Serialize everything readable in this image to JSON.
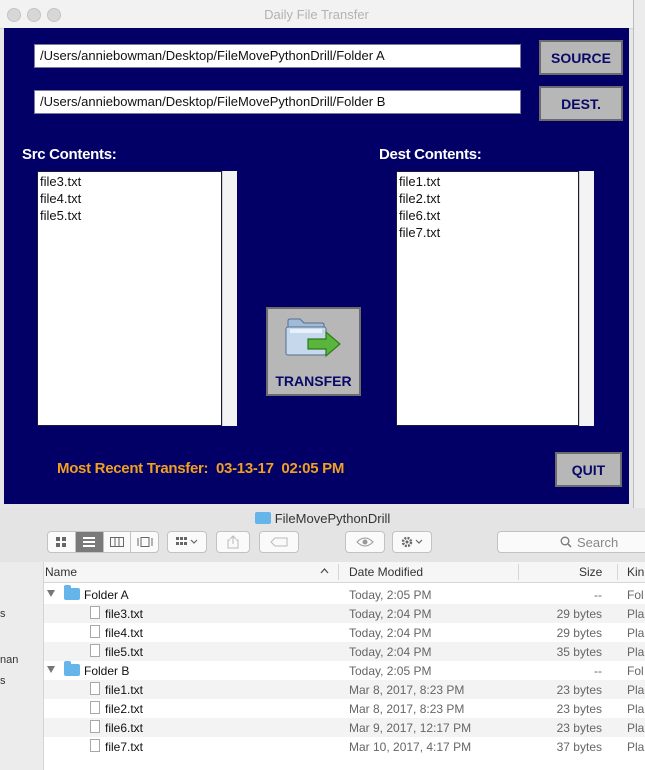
{
  "app": {
    "title": "Daily File Transfer",
    "source_path": "/Users/anniebowman/Desktop/FileMovePythonDrill/Folder A",
    "dest_path": "/Users/anniebowman/Desktop/FileMovePythonDrill/Folder B",
    "source_button": "SOURCE",
    "dest_button": "DEST.",
    "src_label": "Src Contents:",
    "dest_label": "Dest Contents:",
    "src_files": [
      "file3.txt",
      "file4.txt",
      "file5.txt"
    ],
    "dest_files": [
      "file1.txt",
      "file2.txt",
      "file6.txt",
      "file7.txt"
    ],
    "transfer_button": "TRANSFER",
    "recent_label": "Most Recent Transfer:",
    "recent_date": "03-13-17",
    "recent_time": "02:05 PM",
    "quit_button": "QUIT",
    "background_color": "#020066",
    "accent_color": "#f0a020"
  },
  "finder": {
    "title": "FileMovePythonDrill",
    "search_placeholder": "Search",
    "columns": {
      "name": "Name",
      "date": "Date Modified",
      "size": "Size",
      "kind": "Kin"
    },
    "sidebar_fragments": [
      "s",
      "nan",
      "s"
    ],
    "rows": [
      {
        "name": "Folder A",
        "type": "folder",
        "date": "Today, 2:05 PM",
        "size": "--",
        "kind": "Fol"
      },
      {
        "name": "file3.txt",
        "type": "file",
        "date": "Today, 2:04 PM",
        "size": "29 bytes",
        "kind": "Pla"
      },
      {
        "name": "file4.txt",
        "type": "file",
        "date": "Today, 2:04 PM",
        "size": "29 bytes",
        "kind": "Pla"
      },
      {
        "name": "file5.txt",
        "type": "file",
        "date": "Today, 2:04 PM",
        "size": "35 bytes",
        "kind": "Pla"
      },
      {
        "name": "Folder B",
        "type": "folder",
        "date": "Today, 2:05 PM",
        "size": "--",
        "kind": "Fol"
      },
      {
        "name": "file1.txt",
        "type": "file",
        "date": "Mar 8, 2017, 8:23 PM",
        "size": "23 bytes",
        "kind": "Pla"
      },
      {
        "name": "file2.txt",
        "type": "file",
        "date": "Mar 8, 2017, 8:23 PM",
        "size": "23 bytes",
        "kind": "Pla"
      },
      {
        "name": "file6.txt",
        "type": "file",
        "date": "Mar 9, 2017, 12:17 PM",
        "size": "23 bytes",
        "kind": "Pla"
      },
      {
        "name": "file7.txt",
        "type": "file",
        "date": "Mar 10, 2017, 4:17 PM",
        "size": "37 bytes",
        "kind": "Pla"
      }
    ]
  }
}
